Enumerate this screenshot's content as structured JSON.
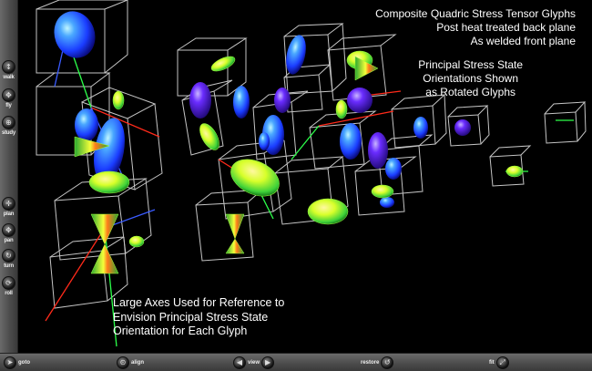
{
  "annotations": {
    "title_lines": [
      "Composite Quadric Stress Tensor Glyphs",
      "Post heat treated back plane",
      "As welded front plane"
    ],
    "orientation_lines": [
      "Principal Stress State",
      "Orientations Shown",
      "as Rotated Glyphs"
    ],
    "axes_lines": [
      "Large Axes Used for Reference to",
      "Envision Principal Stress State",
      "Orientation for Each Glyph"
    ]
  },
  "left_toolbar": {
    "items": [
      {
        "label": "walk",
        "icon": "walk-icon"
      },
      {
        "label": "fly",
        "icon": "fly-icon"
      },
      {
        "label": "study",
        "icon": "study-icon"
      },
      {
        "label": "plan",
        "icon": "plan-icon"
      },
      {
        "label": "pan",
        "icon": "pan-icon"
      },
      {
        "label": "turn",
        "icon": "turn-icon"
      },
      {
        "label": "roll",
        "icon": "roll-icon"
      }
    ]
  },
  "bottom_toolbar": {
    "items": [
      {
        "label": "goto",
        "icon": "goto-icon"
      },
      {
        "label": "align",
        "icon": "align-icon"
      },
      {
        "label": "view",
        "icon": "view-icon"
      },
      {
        "label": "restore",
        "icon": "restore-icon"
      },
      {
        "label": "fit",
        "icon": "fit-icon"
      }
    ]
  },
  "colors": {
    "background": "#000000",
    "cube_edge": "#e8e8e8",
    "glyph_blue": "#2d6bff",
    "glyph_violet": "#6a2cff",
    "glyph_yellow": "#d8ff2a",
    "glyph_green": "#3fd23a",
    "axis_red": "#ff2a1a",
    "axis_green": "#2cff4a",
    "axis_blue": "#3a5bff"
  }
}
